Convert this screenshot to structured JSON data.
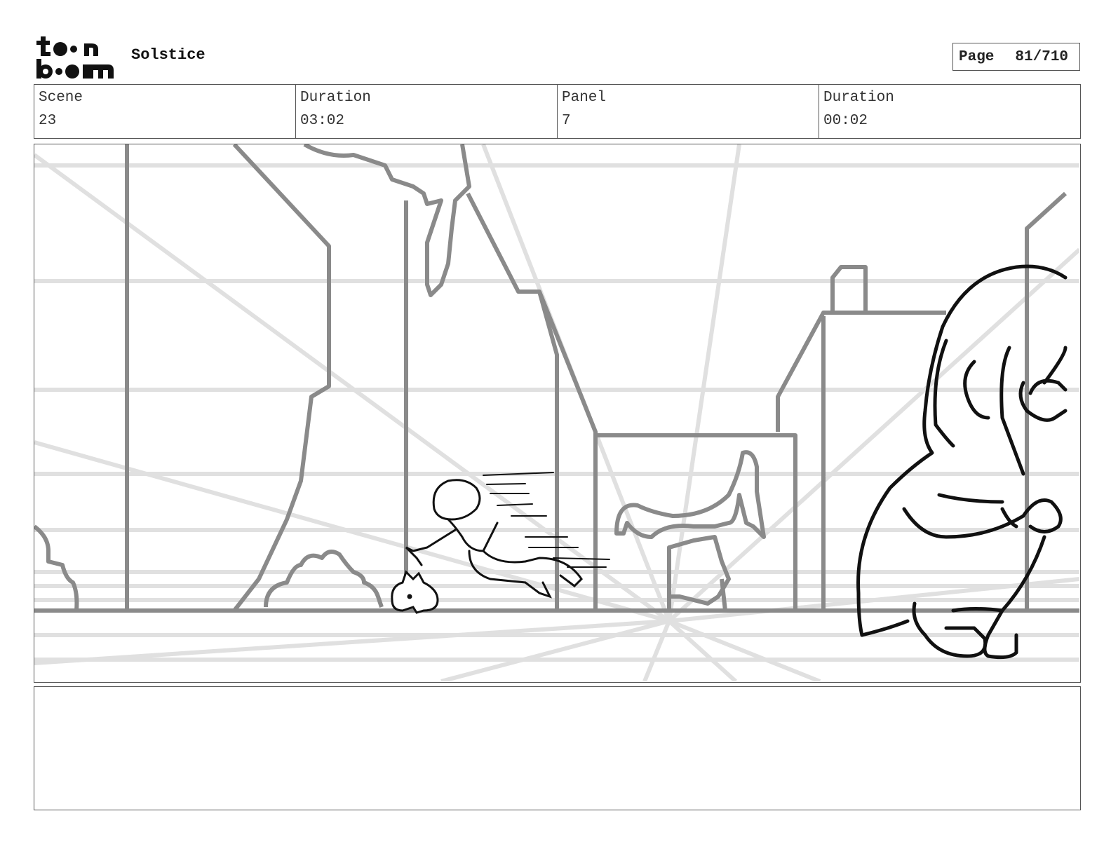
{
  "header": {
    "logo_text": "toonboom",
    "project_title": "Solstice",
    "page_label": "Page",
    "page_value": "81/710"
  },
  "info": [
    {
      "label": "Scene",
      "value": "23"
    },
    {
      "label": "Duration",
      "value": "03:02"
    },
    {
      "label": "Panel",
      "value": "7"
    },
    {
      "label": "Duration",
      "value": "00:02"
    }
  ],
  "panel_image": {
    "icon": "storyboard-sketch",
    "subjects": [
      "running-character",
      "bunny",
      "crouching-girl",
      "ruined-buildings"
    ]
  },
  "notes": {
    "text": ""
  }
}
